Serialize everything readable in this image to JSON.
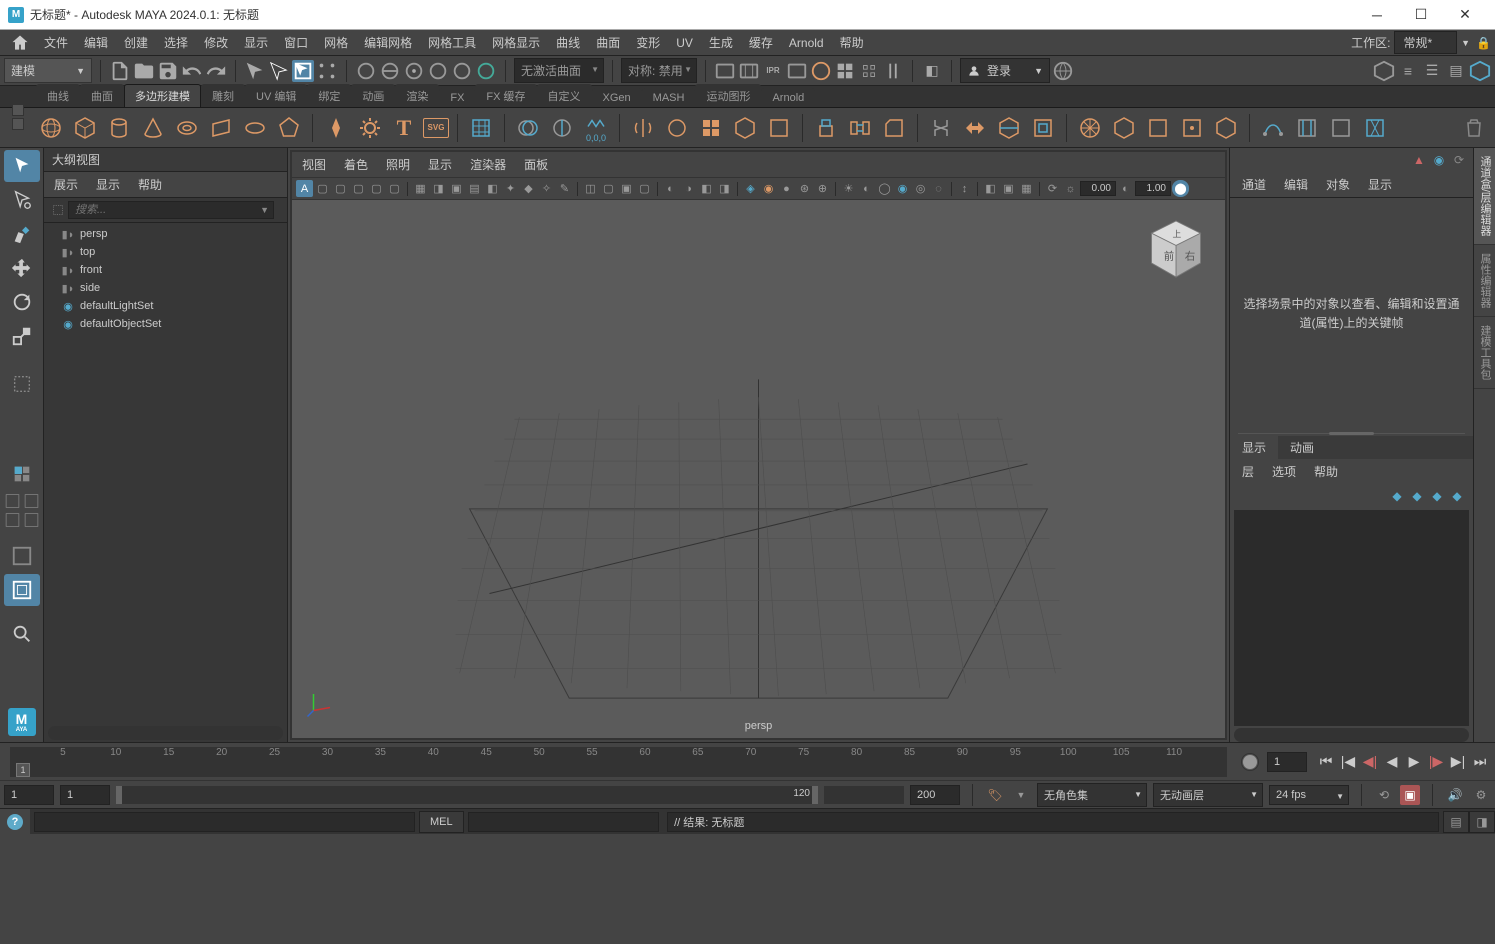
{
  "titlebar": {
    "icon_text": "M",
    "title": "无标题* - Autodesk MAYA 2024.0.1: 无标题"
  },
  "menubar": {
    "items": [
      "文件",
      "编辑",
      "创建",
      "选择",
      "修改",
      "显示",
      "窗口",
      "网格",
      "编辑网格",
      "网格工具",
      "网格显示",
      "曲线",
      "曲面",
      "变形",
      "UV",
      "生成",
      "缓存",
      "Arnold",
      "帮助"
    ],
    "workspace_label": "工作区:",
    "workspace_value": "常规*"
  },
  "statusbar": {
    "module": "建模",
    "no_active_surface": "无激活曲面",
    "symmetry_label": "对称:",
    "symmetry_value": "禁用",
    "login": "登录"
  },
  "shelf": {
    "tabs": [
      "曲线",
      "曲面",
      "多边形建模",
      "雕刻",
      "UV 编辑",
      "绑定",
      "动画",
      "渲染",
      "FX",
      "FX 缓存",
      "自定义",
      "XGen",
      "MASH",
      "运动图形",
      "Arnold"
    ],
    "active_tab_index": 2
  },
  "outliner": {
    "title": "大纲视图",
    "menu": [
      "展示",
      "显示",
      "帮助"
    ],
    "search_placeholder": "搜索...",
    "items": [
      {
        "icon": "camera",
        "label": "persp"
      },
      {
        "icon": "camera",
        "label": "top"
      },
      {
        "icon": "camera",
        "label": "front"
      },
      {
        "icon": "camera",
        "label": "side"
      },
      {
        "icon": "set",
        "label": "defaultLightSet"
      },
      {
        "icon": "set",
        "label": "defaultObjectSet"
      }
    ]
  },
  "viewport": {
    "menu": [
      "视图",
      "着色",
      "照明",
      "显示",
      "渲染器",
      "面板"
    ],
    "near_val": "0.00",
    "far_val": "1.00",
    "camera_label": "persp",
    "cube_front": "前",
    "cube_right": "右",
    "cube_top": "上"
  },
  "channel_box": {
    "tabs": [
      "通道",
      "编辑",
      "对象",
      "显示"
    ],
    "empty_msg": "选择场景中的对象以查看、编辑和设置通道(属性)上的关键帧"
  },
  "layer_editor": {
    "tabs": [
      {
        "label": "显示",
        "active": true
      },
      {
        "label": "动画",
        "active": false
      }
    ],
    "menu": [
      "层",
      "选项",
      "帮助"
    ]
  },
  "right_tabs": [
    "通道盒/层编辑器",
    "属性编辑器",
    "建模工具包"
  ],
  "timeslider": {
    "ticks": [
      5,
      10,
      15,
      20,
      25,
      30,
      35,
      40,
      45,
      50,
      55,
      60,
      65,
      70,
      75,
      80,
      85,
      90,
      95,
      100,
      105,
      110
    ],
    "current_frame": "1",
    "marker": "1"
  },
  "range": {
    "start": "1",
    "range_start": "1",
    "range_end_label": "120",
    "end": "200",
    "charset": "无角色集",
    "animlayer": "无动画层",
    "fps": "24 fps"
  },
  "cmd": {
    "lang": "MEL",
    "result_prefix": "// 结果:",
    "result": "无标题"
  }
}
